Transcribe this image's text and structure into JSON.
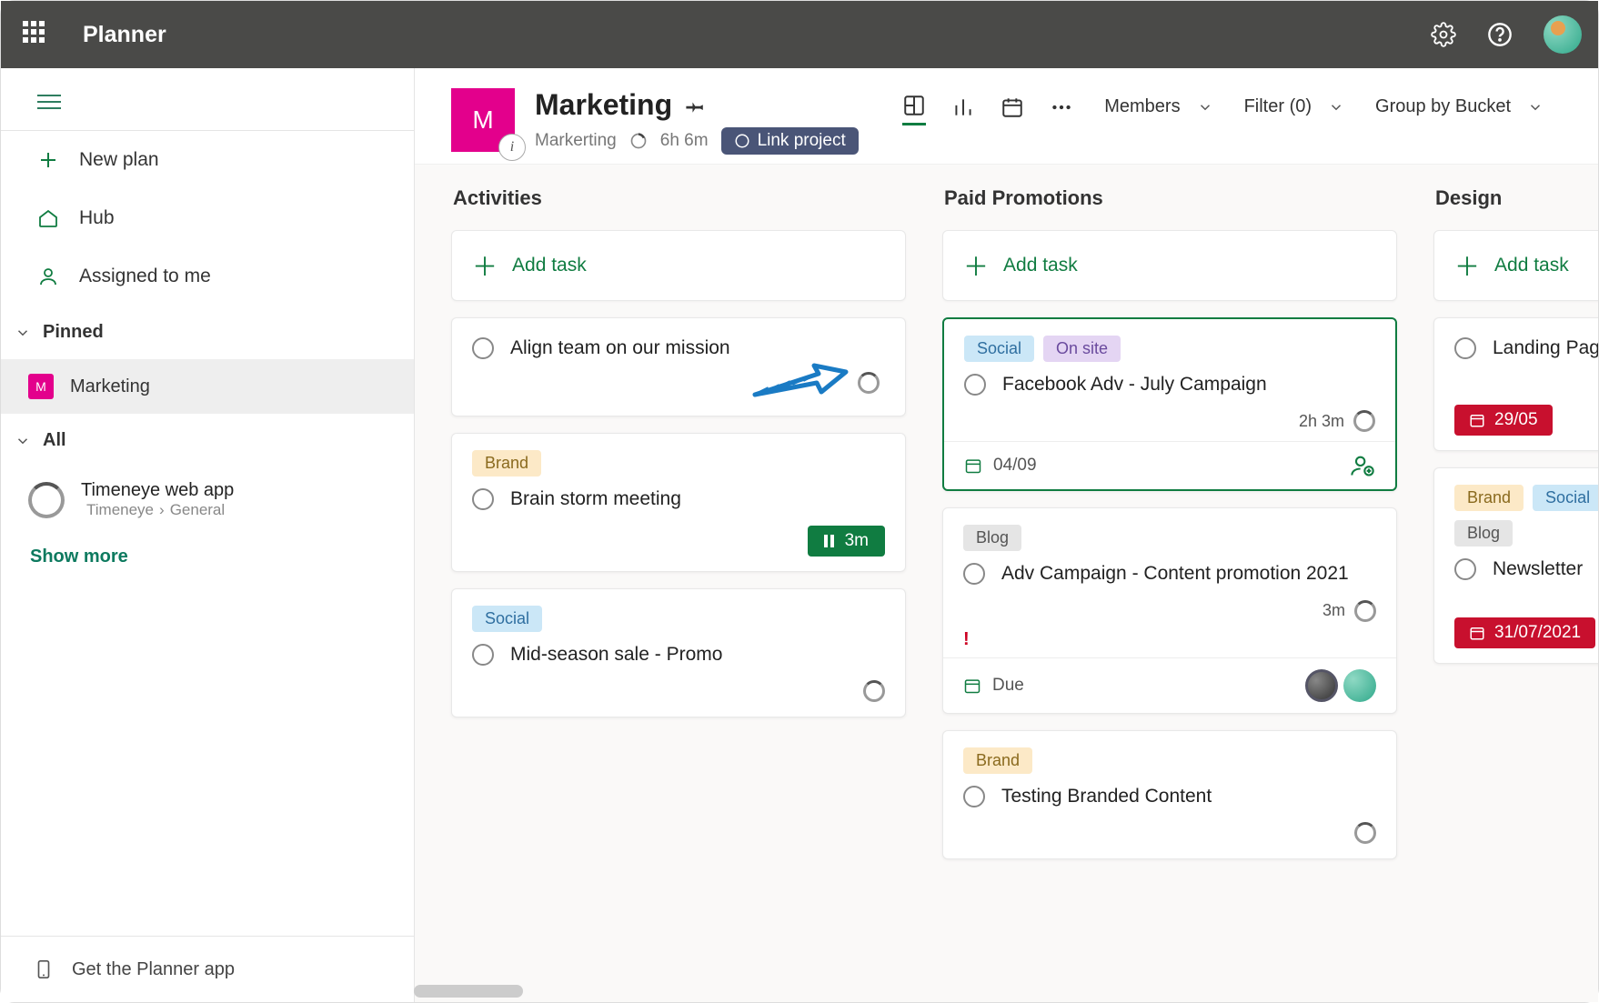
{
  "topbar": {
    "title": "Planner"
  },
  "sidebar": {
    "new_plan": "New plan",
    "hub": "Hub",
    "assigned": "Assigned to me",
    "pinned_header": "Pinned",
    "pinned_item": "Marketing",
    "pinned_letter": "M",
    "all_header": "All",
    "timeneye_title": "Timeneye web app",
    "timeneye_sub1": "Timeneye",
    "timeneye_sub2": "General",
    "show_more": "Show more",
    "footer": "Get the Planner app"
  },
  "plan": {
    "letter": "M",
    "title": "Marketing",
    "sub_name": "Markerting",
    "sub_time": "6h 6m",
    "link_label": "Link project",
    "members": "Members",
    "filter": "Filter (0)",
    "group": "Group by Bucket"
  },
  "buckets": {
    "b1": {
      "title": "Activities",
      "add": "Add task",
      "c1": {
        "title": "Align team on our mission"
      },
      "c2": {
        "tag": "Brand",
        "title": "Brain storm meeting",
        "timer": "3m"
      },
      "c3": {
        "tag": "Social",
        "title": "Mid-season sale - Promo"
      }
    },
    "b2": {
      "title": "Paid Promotions",
      "add": "Add task",
      "c1": {
        "tag1": "Social",
        "tag2": "On site",
        "title": "Facebook Adv - July Campaign",
        "time": "2h 3m",
        "date": "04/09"
      },
      "c2": {
        "tag": "Blog",
        "title": "Adv Campaign - Content promotion 2021",
        "time": "3m",
        "due": "Due"
      },
      "c3": {
        "tag": "Brand",
        "title": "Testing Branded Content"
      }
    },
    "b3": {
      "title": "Design",
      "add": "Add task",
      "c1": {
        "title": "Landing Page meeti",
        "date": "29/05"
      },
      "c2": {
        "tag1": "Brand",
        "tag2": "Social",
        "tag3": "Blog",
        "title": "Newsletter",
        "date": "31/07/2021"
      }
    }
  }
}
